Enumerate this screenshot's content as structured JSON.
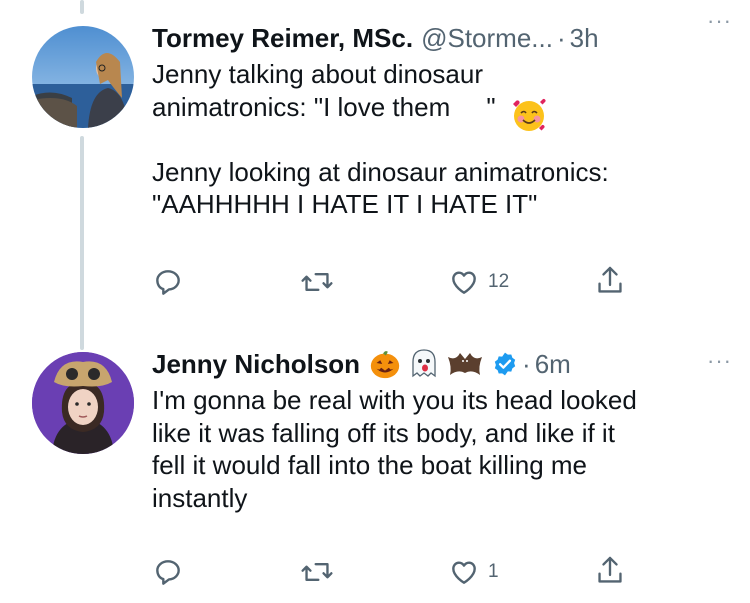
{
  "tweets": [
    {
      "name": "Tormey Reimer, MSc.",
      "handle": "@Storme...",
      "separator": "·",
      "time": "3h",
      "text": "Jenny talking about dinosaur\nanimatronics: \"I love them     \"\n\nJenny looking at dinosaur animatronics:\n\"AAHHHHH I HATE IT I HATE IT\"",
      "text_emoji": "smiling-face-with-hearts",
      "reply_count": "",
      "retweet_count": "",
      "like_count": "12",
      "more_label": "···"
    },
    {
      "name": "Jenny Nicholson",
      "name_emojis": [
        "jack-o-lantern",
        "ghost",
        "bat"
      ],
      "verified": true,
      "separator": "·",
      "time": "6m",
      "text": "I'm gonna be real with you its head looked\nlike it was falling off its body, and like if it\nfell it would fall into the boat killing me\ninstantly",
      "reply_count": "",
      "retweet_count": "",
      "like_count": "1",
      "more_label": "···"
    }
  ],
  "colors": {
    "icon_gray": "#536471",
    "thread_line": "#cfd9de",
    "verified_blue": "#1d9bf0",
    "avatar2_bg": "#6a3fb3"
  }
}
